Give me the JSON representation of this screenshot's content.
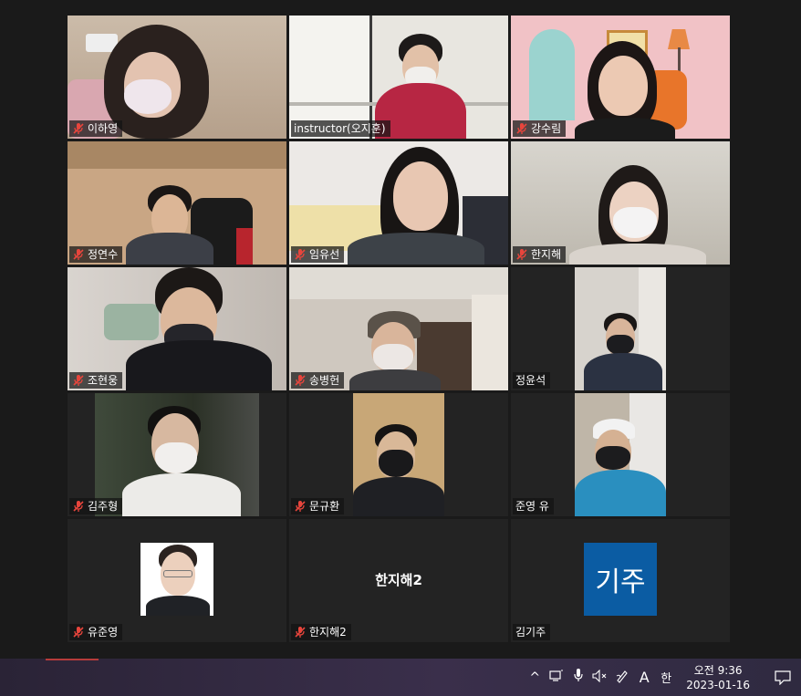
{
  "participants": [
    {
      "name": "이하영",
      "muted": true
    },
    {
      "name": "instructor(오지훈)",
      "muted": false
    },
    {
      "name": "강수림",
      "muted": true
    },
    {
      "name": "정연수",
      "muted": true
    },
    {
      "name": "임유선",
      "muted": true
    },
    {
      "name": "한지해",
      "muted": true
    },
    {
      "name": "조현웅",
      "muted": true
    },
    {
      "name": "송병헌",
      "muted": true
    },
    {
      "name": "정윤석",
      "muted": false
    },
    {
      "name": "김주형",
      "muted": true
    },
    {
      "name": "문규환",
      "muted": true
    },
    {
      "name": "준영 유",
      "muted": false
    },
    {
      "name": "유준영",
      "muted": true
    },
    {
      "name": "한지해2",
      "muted": true,
      "center_text": "한지해2"
    },
    {
      "name": "김기주",
      "muted": false,
      "logo_text": "기주"
    }
  ],
  "taskbar": {
    "time": "오전 9:36",
    "date": "2023-01-16",
    "language_letter": "A",
    "ime_label": "한",
    "chevron_glyph": "^",
    "volume_glyph": "🔇"
  },
  "colors": {
    "active_speaker_border": "#d4d98a",
    "tile_bg": "#232323",
    "window_bg": "#1a1a1a",
    "muted_icon": "#e8453c",
    "logo_bg": "#0b5ca3"
  }
}
